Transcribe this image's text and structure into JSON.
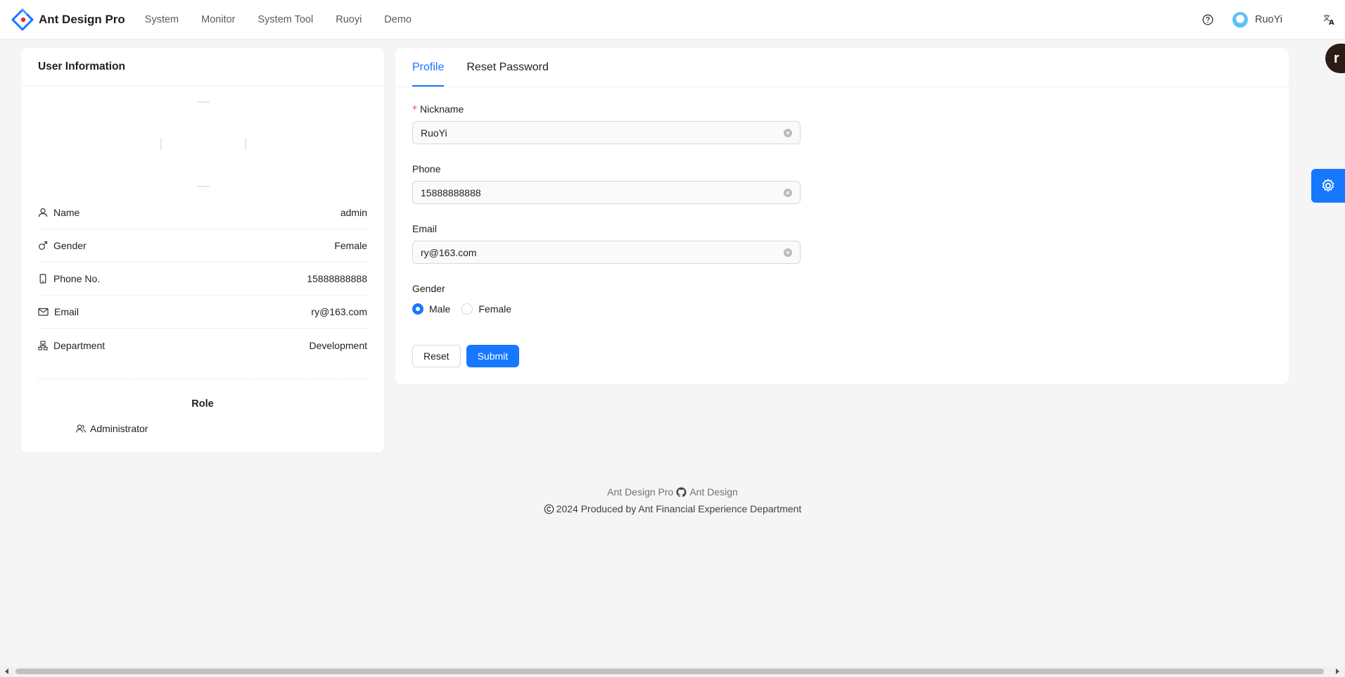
{
  "app": {
    "title": "Ant Design Pro",
    "colors": {
      "primary": "#1677ff",
      "required": "#ff4d4f",
      "settings_button": "#1677ff"
    }
  },
  "header": {
    "nav": [
      "System",
      "Monitor",
      "System Tool",
      "Ruoyi",
      "Demo"
    ],
    "user_name": "RuoYi",
    "icons": {
      "help": "question-circle-icon",
      "language": "translate-icon"
    }
  },
  "floating": {
    "avatar_letter": "r",
    "settings_icon": "gear-icon"
  },
  "user_info": {
    "title": "User Information",
    "rows": [
      {
        "label": "Name",
        "value": "admin",
        "icon": "user-icon"
      },
      {
        "label": "Gender",
        "value": "Female",
        "icon": "male-icon"
      },
      {
        "label": "Phone No.",
        "value": "15888888888",
        "icon": "mobile-icon"
      },
      {
        "label": "Email",
        "value": "ry@163.com",
        "icon": "mail-icon"
      },
      {
        "label": "Department",
        "value": "Development",
        "icon": "cluster-icon"
      }
    ],
    "role_title": "Role",
    "role": "Administrator"
  },
  "tabs": {
    "profile": "Profile",
    "reset_password": "Reset Password",
    "active": "Profile"
  },
  "form": {
    "nickname_label": "Nickname",
    "nickname_required_mark": "*",
    "nickname_value": "RuoYi",
    "phone_label": "Phone",
    "phone_value": "15888888888",
    "email_label": "Email",
    "email_value": "ry@163.com",
    "gender_label": "Gender",
    "gender_options": [
      "Male",
      "Female"
    ],
    "gender_selected": "Male",
    "reset_label": "Reset",
    "submit_label": "Submit"
  },
  "footer": {
    "link1": "Ant Design Pro",
    "link2": "Ant Design",
    "copyright": "2024 Produced by Ant Financial Experience Department"
  }
}
